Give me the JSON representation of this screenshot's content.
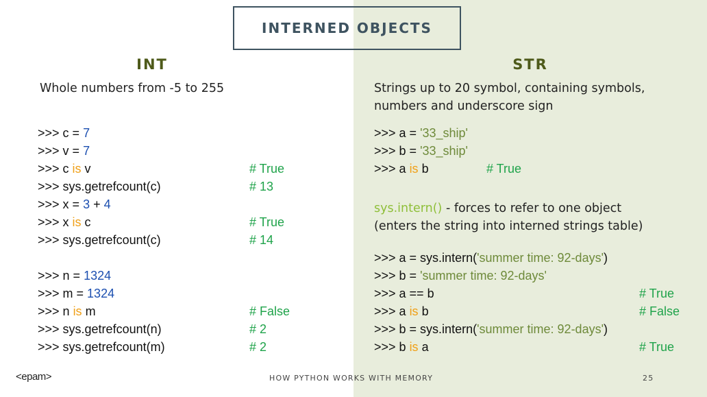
{
  "title": "INTERNED OBJECTS",
  "int": {
    "heading": "INT",
    "description": "Whole numbers from -5 to 255",
    "lines": [
      {
        "segs": [
          {
            "t": ">>> c = ",
            "c": ""
          },
          {
            "t": "7",
            "c": "num"
          }
        ],
        "comment": ""
      },
      {
        "segs": [
          {
            "t": ">>> v = ",
            "c": ""
          },
          {
            "t": "7",
            "c": "num"
          }
        ],
        "comment": ""
      },
      {
        "segs": [
          {
            "t": ">>> c ",
            "c": ""
          },
          {
            "t": "is",
            "c": "kw"
          },
          {
            "t": " v",
            "c": ""
          }
        ],
        "comment": "# True"
      },
      {
        "segs": [
          {
            "t": ">>> sys.getrefcount(c)",
            "c": ""
          }
        ],
        "comment": "# 13"
      },
      {
        "segs": [
          {
            "t": ">>> x = ",
            "c": ""
          },
          {
            "t": "3",
            "c": "num"
          },
          {
            "t": " + ",
            "c": ""
          },
          {
            "t": "4",
            "c": "num"
          }
        ],
        "comment": ""
      },
      {
        "segs": [
          {
            "t": ">>> x ",
            "c": ""
          },
          {
            "t": "is",
            "c": "kw"
          },
          {
            "t": " c",
            "c": ""
          }
        ],
        "comment": "# True"
      },
      {
        "segs": [
          {
            "t": ">>> sys.getrefcount(c)",
            "c": ""
          }
        ],
        "comment": "# 14"
      },
      {
        "segs": [
          {
            "t": ">>> n = ",
            "c": ""
          },
          {
            "t": "1324",
            "c": "num"
          }
        ],
        "comment": ""
      },
      {
        "segs": [
          {
            "t": ">>> m = ",
            "c": ""
          },
          {
            "t": "1324",
            "c": "num"
          }
        ],
        "comment": ""
      },
      {
        "segs": [
          {
            "t": ">>> n ",
            "c": ""
          },
          {
            "t": "is",
            "c": "kw"
          },
          {
            "t": " m",
            "c": ""
          }
        ],
        "comment": "# False"
      },
      {
        "segs": [
          {
            "t": ">>> sys.getrefcount(n)",
            "c": ""
          }
        ],
        "comment": "# 2"
      },
      {
        "segs": [
          {
            "t": ">>> sys.getrefcount(m)",
            "c": ""
          }
        ],
        "comment": "# 2"
      }
    ]
  },
  "str": {
    "heading": "STR",
    "description_lines": [
      "Strings up to 20 symbol, containing symbols,",
      "numbers and underscore sign"
    ],
    "lines_a": [
      {
        "segs": [
          {
            "t": ">>> a = ",
            "c": ""
          },
          {
            "t": "'33_ship'",
            "c": "str"
          }
        ],
        "comment": ""
      },
      {
        "segs": [
          {
            "t": ">>> b = ",
            "c": ""
          },
          {
            "t": "'33_ship'",
            "c": "str"
          }
        ],
        "comment": ""
      },
      {
        "segs": [
          {
            "t": ">>> a ",
            "c": ""
          },
          {
            "t": "is",
            "c": "kw"
          },
          {
            "t": " b",
            "c": ""
          }
        ],
        "comment": "# True"
      }
    ],
    "intern_fn": "sys.intern()",
    "intern_desc_1": " - forces to refer to one object",
    "intern_desc_2": "(enters the string into interned strings table)",
    "lines_b": [
      {
        "segs": [
          {
            "t": ">>> a = sys.intern(",
            "c": ""
          },
          {
            "t": "'summer time: 92-days'",
            "c": "str"
          },
          {
            "t": ")",
            "c": ""
          }
        ],
        "comment": ""
      },
      {
        "segs": [
          {
            "t": ">>> b = ",
            "c": ""
          },
          {
            "t": "'summer time: 92-days'",
            "c": "str"
          }
        ],
        "comment": ""
      },
      {
        "segs": [
          {
            "t": ">>> a == b",
            "c": ""
          }
        ],
        "comment": "# True"
      },
      {
        "segs": [
          {
            "t": ">>> a ",
            "c": ""
          },
          {
            "t": "is",
            "c": "kw"
          },
          {
            "t": " b",
            "c": ""
          }
        ],
        "comment": "# False"
      },
      {
        "segs": [
          {
            "t": ">>> b = sys.intern(",
            "c": ""
          },
          {
            "t": "'summer time: 92-days'",
            "c": "str"
          },
          {
            "t": ")",
            "c": ""
          }
        ],
        "comment": ""
      },
      {
        "segs": [
          {
            "t": ">>> b ",
            "c": ""
          },
          {
            "t": "is",
            "c": "kw"
          },
          {
            "t": " a",
            "c": ""
          }
        ],
        "comment": "# True"
      }
    ]
  },
  "footer": {
    "logo": "<epam>",
    "caption": "HOW PYTHON WORKS WITH MEMORY",
    "page": "25"
  },
  "colors": {
    "accent": "#4e5a1a",
    "right_bg": "#e8eddc",
    "comment": "#1fa34a",
    "number": "#1c4fb0",
    "keyword": "#f0a018",
    "string": "#6e8a3a"
  }
}
